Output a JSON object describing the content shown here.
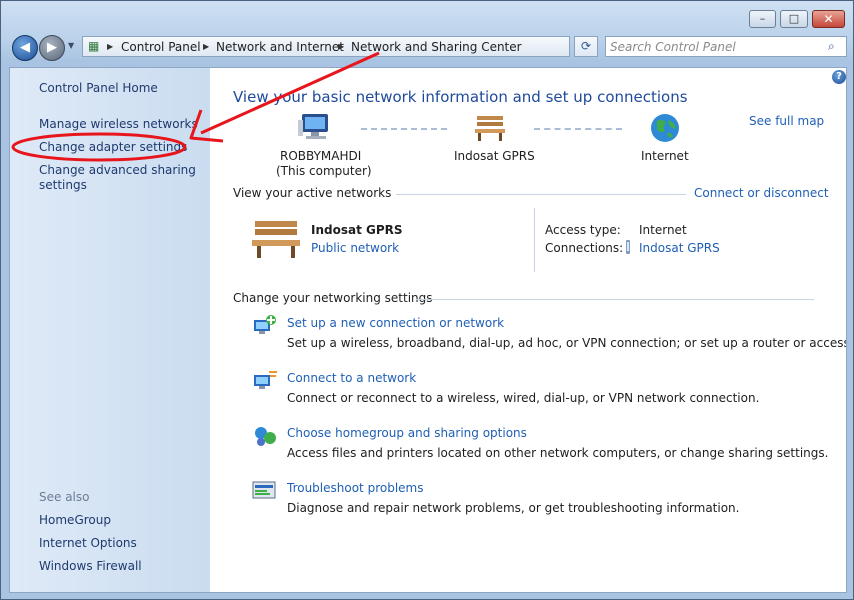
{
  "window": {
    "minimize_glyph": "–",
    "maximize_glyph": "□",
    "close_glyph": "✕"
  },
  "address": {
    "crumbs": [
      "Control Panel",
      "Network and Internet",
      "Network and Sharing Center"
    ],
    "icon": "control-panel-icon"
  },
  "search": {
    "placeholder": "Search Control Panel"
  },
  "sidebar": {
    "home": "Control Panel Home",
    "items": [
      "Manage wireless networks",
      "Change adapter settings",
      "Change advanced sharing settings"
    ],
    "see_also_label": "See also",
    "see_also": [
      "HomeGroup",
      "Internet Options",
      "Windows Firewall"
    ]
  },
  "main": {
    "heading": "View your basic network information and set up connections",
    "see_full_map": "See full map",
    "map": {
      "computer_name": "ROBBYMAHDI",
      "computer_sub": "(This computer)",
      "network_name": "Indosat GPRS",
      "internet": "Internet"
    },
    "active": {
      "label": "View your active networks",
      "connect_link": "Connect or disconnect",
      "name": "Indosat GPRS",
      "type_link": "Public network",
      "access_type_label": "Access type:",
      "access_type_value": "Internet",
      "connections_label": "Connections:",
      "connections_value": "Indosat GPRS"
    },
    "settings": {
      "label": "Change your networking settings",
      "tasks": [
        {
          "title": "Set up a new connection or network",
          "desc": "Set up a wireless, broadband, dial-up, ad hoc, or VPN connection; or set up a router or access point."
        },
        {
          "title": "Connect to a network",
          "desc": "Connect or reconnect to a wireless, wired, dial-up, or VPN network connection."
        },
        {
          "title": "Choose homegroup and sharing options",
          "desc": "Access files and printers located on other network computers, or change sharing settings."
        },
        {
          "title": "Troubleshoot problems",
          "desc": "Diagnose and repair network problems, or get troubleshooting information."
        }
      ]
    }
  },
  "annotation": {
    "color": "#e8161c"
  },
  "colors": {
    "link": "#1f5fb5",
    "heading": "#1e4a9c",
    "sidebar_link": "#1e3a6e"
  }
}
